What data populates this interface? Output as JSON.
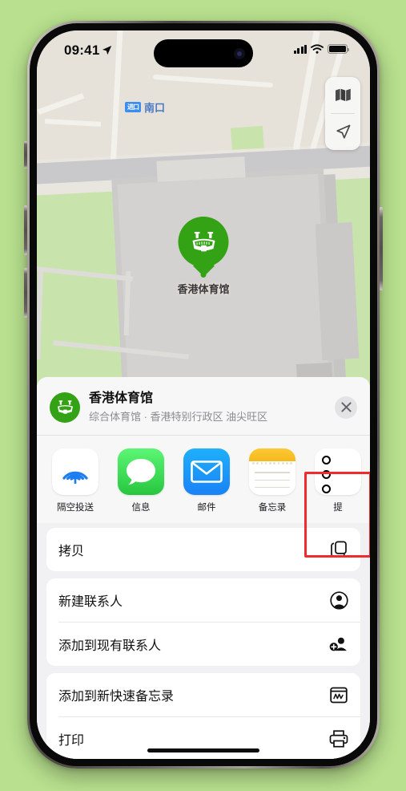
{
  "status_bar": {
    "time": "09:41",
    "location_arrow_icon": "location-arrow-icon",
    "signal_icon": "cellular-signal-icon",
    "wifi_icon": "wifi-icon",
    "battery_icon": "battery-icon"
  },
  "map": {
    "entrance_badge": "进口",
    "entrance_label": "南口",
    "poi_label": "香港体育馆",
    "poi_pin_icon": "stadium-pin-icon",
    "controls": [
      {
        "name": "map-layers-button",
        "icon": "map-icon"
      },
      {
        "name": "current-location-button",
        "icon": "location-arrow-icon"
      }
    ]
  },
  "share_sheet": {
    "poi_icon": "stadium-icon",
    "title": "香港体育馆",
    "subtitle": "综合体育馆 · 香港特别行政区 油尖旺区",
    "close_icon": "close-icon",
    "apps": [
      {
        "label": "隔空投送",
        "icon": "airdrop-icon",
        "highlighted": false
      },
      {
        "label": "信息",
        "icon": "messages-icon",
        "highlighted": false
      },
      {
        "label": "邮件",
        "icon": "mail-icon",
        "highlighted": false
      },
      {
        "label": "备忘录",
        "icon": "notes-icon",
        "highlighted": true
      },
      {
        "label": "提",
        "icon": "reminders-icon",
        "highlighted": false
      }
    ],
    "actions": [
      {
        "label": "拷贝",
        "icon": "copy-icon"
      },
      {
        "label": "新建联系人",
        "icon": "new-contact-icon"
      },
      {
        "label": "添加到现有联系人",
        "icon": "add-to-contact-icon"
      },
      {
        "label": "添加到新快速备忘录",
        "icon": "quick-note-icon"
      },
      {
        "label": "打印",
        "icon": "print-icon"
      }
    ]
  },
  "colors": {
    "background": "#b8e08e",
    "poi_green": "#34a215",
    "highlight_red": "#ef2b2b",
    "accent_blue": "#3b8ef0"
  }
}
